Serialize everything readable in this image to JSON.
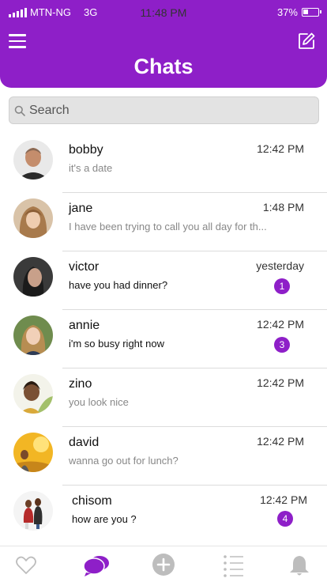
{
  "status_bar": {
    "carrier": "MTN-NG",
    "network": "3G",
    "time": "11:48 PM",
    "battery": "37%"
  },
  "header": {
    "title": "Chats",
    "menu_icon": "hamburger-menu-icon",
    "compose_icon": "compose-icon"
  },
  "search": {
    "placeholder": "Search",
    "icon": "search-icon"
  },
  "chats": [
    {
      "name": "bobby",
      "time": "12:42 PM",
      "message": "it's a date",
      "unread": null
    },
    {
      "name": "jane",
      "time": "1:48 PM",
      "message": "I have been trying to call you all day for th...",
      "unread": null
    },
    {
      "name": "victor",
      "time": "yesterday",
      "message": "have you had dinner?",
      "unread": "1"
    },
    {
      "name": "annie",
      "time": "12:42 PM",
      "message": "i'm so busy right now",
      "unread": "3"
    },
    {
      "name": "zino",
      "time": "12:42 PM",
      "message": "you look nice",
      "unread": null
    },
    {
      "name": "david",
      "time": "12:42 PM",
      "message": "wanna go out for lunch?",
      "unread": null
    },
    {
      "name": "chisom",
      "time": "12:42 PM",
      "message": "how are you ?",
      "unread": "4"
    }
  ],
  "tabbar": [
    {
      "icon": "heart-icon",
      "active": false
    },
    {
      "icon": "chat-bubbles-icon",
      "active": true
    },
    {
      "icon": "add-circle-icon",
      "active": false
    },
    {
      "icon": "list-icon",
      "active": false
    },
    {
      "icon": "bell-icon",
      "active": false
    }
  ],
  "colors": {
    "accent": "#8e1fc8",
    "inactive_icon": "#bdbdbd",
    "search_bg": "#e3e3e3"
  }
}
